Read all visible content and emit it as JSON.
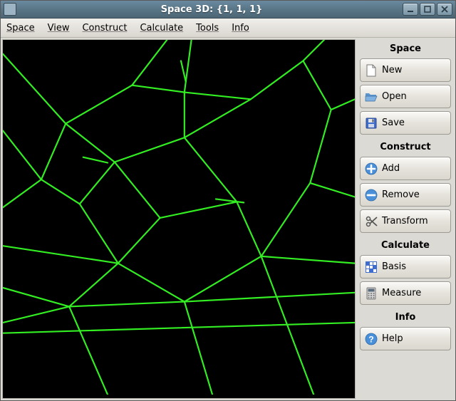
{
  "window": {
    "title": "Space 3D: {1, 1, 1}"
  },
  "menubar": [
    {
      "label": "Space"
    },
    {
      "label": "View"
    },
    {
      "label": "Construct"
    },
    {
      "label": "Calculate"
    },
    {
      "label": "Tools"
    },
    {
      "label": "Info"
    }
  ],
  "sidebar": {
    "space": {
      "header": "Space",
      "new": "New",
      "open": "Open",
      "save": "Save"
    },
    "construct": {
      "header": "Construct",
      "add": "Add",
      "remove": "Remove",
      "transform": "Transform"
    },
    "calculate": {
      "header": "Calculate",
      "basis": "Basis",
      "measure": "Measure"
    },
    "info": {
      "header": "Info",
      "help": "Help"
    }
  }
}
